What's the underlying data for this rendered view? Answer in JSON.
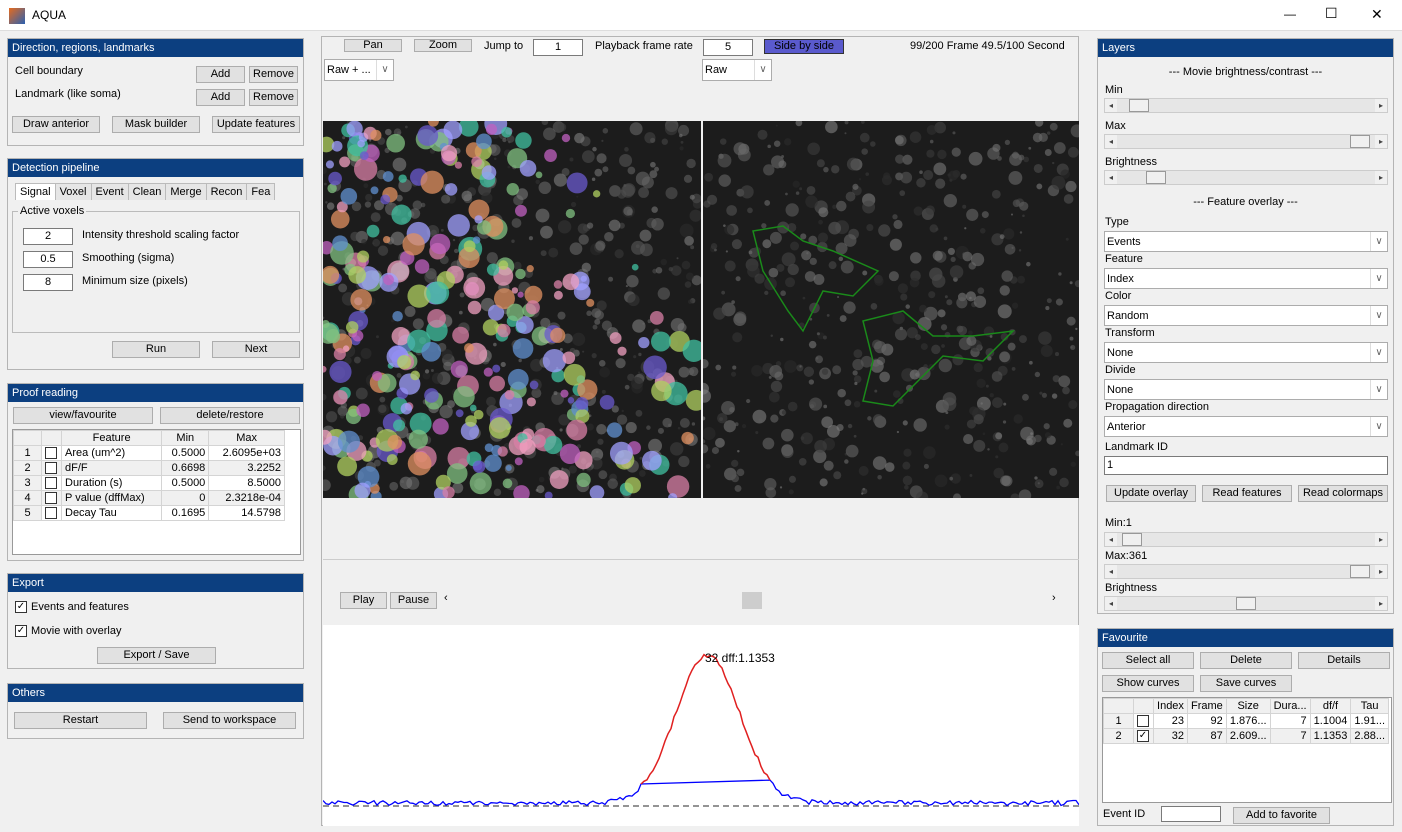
{
  "window": {
    "title": "AQUA",
    "minimize": "—",
    "maximize": "☐",
    "close": "✕"
  },
  "direction": {
    "title": "Direction, regions, landmarks",
    "cell_boundary": "Cell boundary",
    "landmark": "Landmark (like soma)",
    "add": "Add",
    "remove": "Remove",
    "draw_anterior": "Draw anterior",
    "mask_builder": "Mask builder",
    "update_features": "Update features"
  },
  "detection": {
    "title": "Detection pipeline",
    "tabs": [
      "Signal",
      "Voxel",
      "Event",
      "Clean",
      "Merge",
      "Recon",
      "Fea"
    ],
    "group": "Active voxels",
    "params": [
      {
        "value": "2",
        "label": "Intensity threshold scaling factor"
      },
      {
        "value": "0.5",
        "label": "Smoothing (sigma)"
      },
      {
        "value": "8",
        "label": "Minimum size (pixels)"
      }
    ],
    "run": "Run",
    "next": "Next"
  },
  "proof": {
    "title": "Proof reading",
    "view_fav": "view/favourite",
    "delete_restore": "delete/restore",
    "columns": [
      "Feature",
      "Min",
      "Max"
    ],
    "rows": [
      {
        "n": "1",
        "feature": "Area (um^2)",
        "min": "0.5000",
        "max": "2.6095e+03"
      },
      {
        "n": "2",
        "feature": "dF/F",
        "min": "0.6698",
        "max": "3.2252"
      },
      {
        "n": "3",
        "feature": "Duration (s)",
        "min": "0.5000",
        "max": "8.5000"
      },
      {
        "n": "4",
        "feature": "P value (dffMax)",
        "min": "0",
        "max": "2.3218e-04"
      },
      {
        "n": "5",
        "feature": "Decay Tau",
        "min": "0.1695",
        "max": "14.5798"
      }
    ]
  },
  "export": {
    "title": "Export",
    "events": "Events and features",
    "movie": "Movie with overlay",
    "events_checked": true,
    "movie_checked": true,
    "save": "Export / Save"
  },
  "others": {
    "title": "Others",
    "restart": "Restart",
    "workspace": "Send to workspace"
  },
  "toolbar": {
    "pan": "Pan",
    "zoom": "Zoom",
    "jump_to": "Jump to",
    "jump_value": "1",
    "rate_label": "Playback frame rate",
    "rate_value": "5",
    "side_by_side": "Side by side",
    "frame_info": "99/200 Frame  49.5/100 Second",
    "left_view": "Raw + ...",
    "right_view": "Raw"
  },
  "playback": {
    "play": "Play",
    "pause": "Pause",
    "position": 0.5
  },
  "curve": {
    "label": "32 dff:1.1353",
    "colors": {
      "baseline": "#0000ff",
      "event": "#e02020",
      "dash": "#555555"
    }
  },
  "layers": {
    "title": "Layers",
    "movie_header": "--- Movie brightness/contrast ---",
    "min": "Min",
    "max": "Max",
    "brightness": "Brightness",
    "min_pos": 0.05,
    "max_pos": 0.98,
    "bright_pos": 0.12,
    "overlay_header": "--- Feature overlay ---",
    "fields": [
      {
        "label": "Type",
        "value": "Events"
      },
      {
        "label": "Feature",
        "value": "Index"
      },
      {
        "label": "Color",
        "value": "Random"
      },
      {
        "label": "Transform",
        "value": "None"
      },
      {
        "label": "Divide",
        "value": "None"
      },
      {
        "label": "Propagation direction",
        "value": "Anterior"
      }
    ],
    "landmark_label": "Landmark ID",
    "landmark_value": "1",
    "update_overlay": "Update overlay",
    "read_features": "Read features",
    "read_colormaps": "Read colormaps",
    "min2": "Min:1",
    "max2": "Max:361",
    "brightness2": "Brightness",
    "min2_pos": 0.02,
    "max2_pos": 0.98,
    "bright2_pos": 0.5
  },
  "favourite": {
    "title": "Favourite",
    "select_all": "Select all",
    "delete": "Delete",
    "details": "Details",
    "show_curves": "Show curves",
    "save_curves": "Save curves",
    "columns": [
      "Index",
      "Frame",
      "Size",
      "Dura...",
      "df/f",
      "Tau"
    ],
    "rows": [
      {
        "n": "1",
        "checked": false,
        "index": "23",
        "frame": "92",
        "size": "1.876...",
        "dur": "7",
        "dff": "1.1004",
        "tau": "1.91..."
      },
      {
        "n": "2",
        "checked": true,
        "index": "32",
        "frame": "87",
        "size": "2.609...",
        "dur": "7",
        "dff": "1.1353",
        "tau": "2.88..."
      }
    ],
    "event_id_label": "Event ID",
    "event_id_value": "",
    "add_favorite": "Add to favorite"
  },
  "colors": {
    "header": "#0c3f80",
    "side_by_side": "#5a5acd",
    "overlay_outline": "#1a8a1a"
  }
}
